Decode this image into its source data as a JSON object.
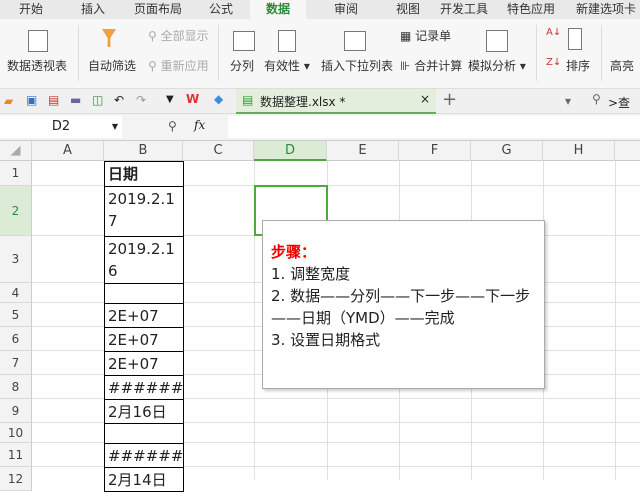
{
  "menu_tabs": [
    "开始",
    "插入",
    "页面布局",
    "公式",
    "数据",
    "审阅",
    "视图",
    "开发工具",
    "特色应用",
    "新建选项卡"
  ],
  "active_tab": "数据",
  "ribbon": {
    "pivot": "数据透视表",
    "autofilter": "自动筛选",
    "show_all": "全部显示",
    "reapply": "重新应用",
    "split": "分列",
    "validity": "有效性",
    "insert_dropdown": "插入下拉列表",
    "record": "记录单",
    "consolidate": "合并计算",
    "whatif": "模拟分析",
    "sort": "排序",
    "more": "高亮"
  },
  "doc_tab": {
    "name": "数据整理.xlsx *"
  },
  "search_label": ">查",
  "name_box": "D2",
  "fx": "fx",
  "columns": [
    "A",
    "B",
    "C",
    "D",
    "E",
    "F",
    "G",
    "H"
  ],
  "rows": [
    "1",
    "2",
    "3",
    "4",
    "5",
    "6",
    "7",
    "8",
    "9",
    "10",
    "11",
    "12"
  ],
  "cells_b": [
    "日期",
    "2019.2.17",
    "2019.2.16",
    "",
    "2E+07",
    "2E+07",
    "2E+07",
    "#######",
    "2月16日",
    "",
    "#######",
    "2月14日"
  ],
  "comment": {
    "title": "步骤：",
    "lines": [
      "1. 调整宽度",
      "2. 数据——分列——下一步——下一步——日期（YMD）——完成",
      "3. 设置日期格式"
    ]
  }
}
